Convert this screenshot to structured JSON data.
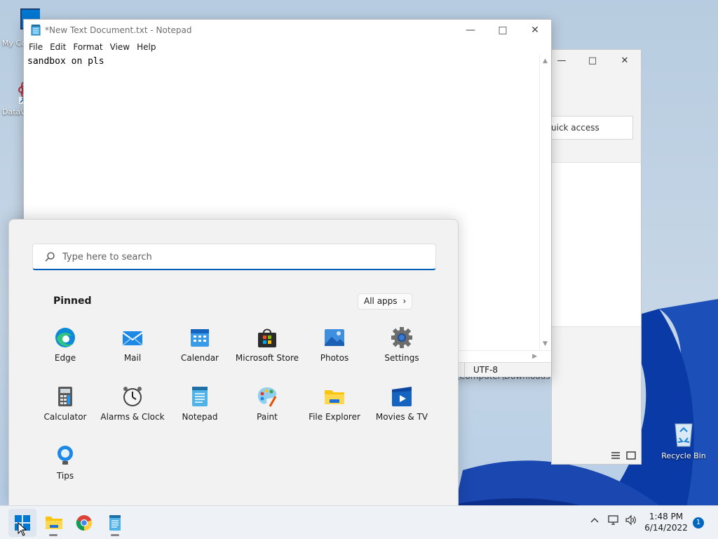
{
  "desktop": {
    "icons": [
      {
        "label": "My Co",
        "icon": "computer-icon"
      },
      {
        "label": "DataW",
        "icon": "datawrapper-icon"
      },
      {
        "label": "Recycle Bin",
        "icon": "recycle-bin-icon"
      }
    ]
  },
  "explorer": {
    "quick_access": "uick access",
    "path": "\\Computer\\Downloads"
  },
  "notepad": {
    "title": "*New Text Document.txt - Notepad",
    "menu": [
      "File",
      "Edit",
      "Format",
      "View",
      "Help"
    ],
    "content": "sandbox on pls",
    "encoding": "UTF-8"
  },
  "start_menu": {
    "search_placeholder": "Type here to search",
    "pinned_heading": "Pinned",
    "all_apps_label": "All apps",
    "pinned": [
      {
        "label": "Edge",
        "icon": "edge-icon"
      },
      {
        "label": "Mail",
        "icon": "mail-icon"
      },
      {
        "label": "Calendar",
        "icon": "calendar-icon"
      },
      {
        "label": "Microsoft Store",
        "icon": "store-icon"
      },
      {
        "label": "Photos",
        "icon": "photos-icon"
      },
      {
        "label": "Settings",
        "icon": "gear-icon"
      },
      {
        "label": "Calculator",
        "icon": "calculator-icon"
      },
      {
        "label": "Alarms & Clock",
        "icon": "clock-icon"
      },
      {
        "label": "Notepad",
        "icon": "notepad-icon"
      },
      {
        "label": "Paint",
        "icon": "paint-icon"
      },
      {
        "label": "File Explorer",
        "icon": "folder-icon"
      },
      {
        "label": "Movies & TV",
        "icon": "movies-icon"
      },
      {
        "label": "Tips",
        "icon": "tips-icon"
      }
    ]
  },
  "taskbar": {
    "time": "1:48 PM",
    "date": "6/14/2022",
    "notification_count": "1"
  },
  "colors": {
    "accent": "#005fb8",
    "taskbar": "#eef1f5",
    "start_bg": "#f2f2f2"
  }
}
